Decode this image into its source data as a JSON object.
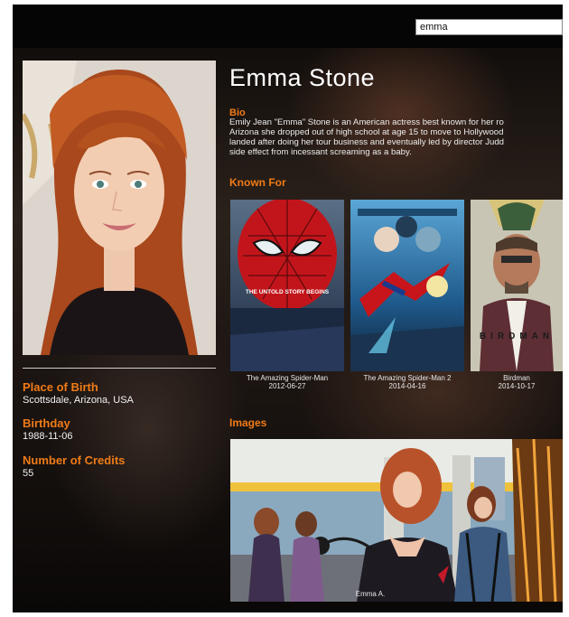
{
  "search": {
    "value": "emma"
  },
  "person": {
    "name": "Emma Stone",
    "bio_label": "Bio",
    "bio_text": "Emily Jean \"Emma\" Stone is an American actress best known for her ro\nArizona she dropped out of high school at age 15 to move to Hollywood\nlanded after doing her tour business and eventually led by director Judd\nside effect from incessant screaming as a baby.",
    "known_for_label": "Known For",
    "images_label": "Images",
    "details": [
      {
        "label": "Place of Birth",
        "value": "Scottsdale, Arizona, USA"
      },
      {
        "label": "Birthday",
        "value": "1988-11-06"
      },
      {
        "label": "Number of Credits",
        "value": "55"
      }
    ]
  },
  "known_for": [
    {
      "title": "The Amazing Spider-Man",
      "date": "2012-06-27"
    },
    {
      "title": "The Amazing Spider-Man 2",
      "date": "2014-04-16"
    },
    {
      "title": "Birdman",
      "date": "2014-10-17"
    }
  ],
  "poster_text": {
    "p1_tagline": "THE UNTOLD STORY BEGINS",
    "p3_title": "BIRDMAN"
  },
  "images": [
    {
      "caption": "Emma A."
    }
  ],
  "colors": {
    "accent": "#f07b17",
    "topbar": "#050505",
    "text": "#ffffff"
  }
}
